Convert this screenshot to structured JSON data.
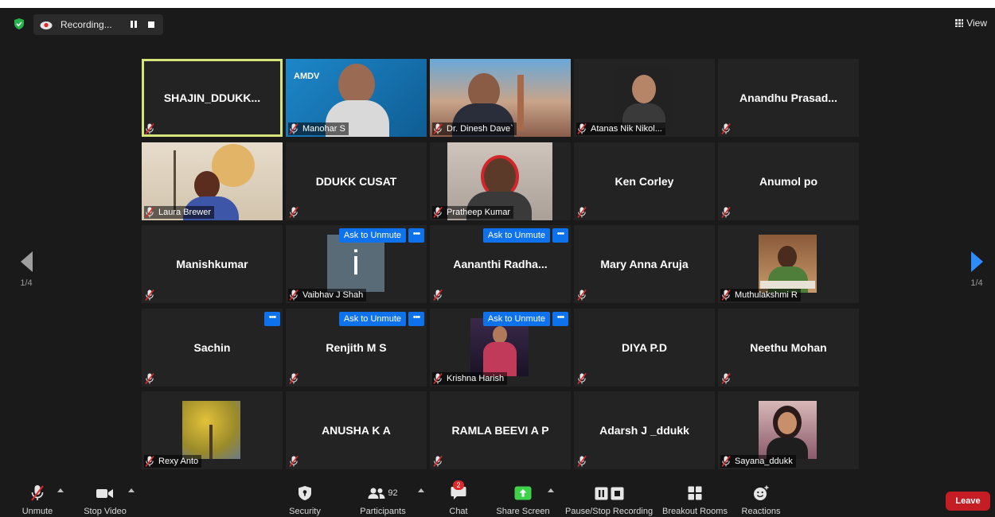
{
  "topbar": {
    "recording_label": "Recording...",
    "view_label": "View",
    "colors": {
      "shield": "#24b24b",
      "background": "#1a1a1a"
    }
  },
  "pagination": {
    "left_label": "1/4",
    "right_label": "1/4"
  },
  "tiles": [
    {
      "name": "SHAJIN_DDUKK...",
      "label": "",
      "active": true
    },
    {
      "name": "",
      "label": "Manohar S",
      "video": "amdv-presenter",
      "logo": "AMDV"
    },
    {
      "name": "",
      "label": "Dr. Dinesh Dave`",
      "video": "city-headset"
    },
    {
      "name": "",
      "label": "Atanas Nik Nikol...",
      "video": "portrait-small"
    },
    {
      "name": "Anandhu  Prasad...",
      "label": ""
    },
    {
      "name": "",
      "label": "Laura Brewer",
      "video": "living-room"
    },
    {
      "name": "DDUKK CUSAT",
      "label": ""
    },
    {
      "name": "",
      "label": "Pratheep Kumar",
      "video": "headphones"
    },
    {
      "name": "Ken Corley",
      "label": ""
    },
    {
      "name": "Anumol po",
      "label": ""
    },
    {
      "name": "Manishkumar",
      "label": ""
    },
    {
      "name": "",
      "label": "Vaibhav J Shah",
      "avatar_letter": "i",
      "ask_label": "Ask to Unmute",
      "more": true
    },
    {
      "name": "Aananthi  Radha...",
      "label": "",
      "ask_label": "Ask to Unmute",
      "more": true
    },
    {
      "name": "Mary Anna Aruja",
      "label": ""
    },
    {
      "name": "",
      "label": "Muthulakshmi R",
      "video": "office-photo"
    },
    {
      "name": "Sachin",
      "label": "",
      "more": true
    },
    {
      "name": "Renjith M S",
      "label": "",
      "ask_label": "Ask to Unmute",
      "more": true
    },
    {
      "name": "",
      "label": "Krishna Harish",
      "video": "stage-photo",
      "ask_label": "Ask to Unmute",
      "more": true
    },
    {
      "name": "DIYA P.D",
      "label": ""
    },
    {
      "name": "Neethu Mohan",
      "label": ""
    },
    {
      "name": "",
      "label": "Rexy Anto",
      "video": "tree-photo"
    },
    {
      "name": "ANUSHA K A",
      "label": ""
    },
    {
      "name": "RAMLA BEEVI A P",
      "label": ""
    },
    {
      "name": "Adarsh J _ddukk",
      "label": ""
    },
    {
      "name": "",
      "label": "Sayana_ddukk",
      "video": "selfie-photo"
    }
  ],
  "toolbar": {
    "unmute": "Unmute",
    "stop_video": "Stop Video",
    "security": "Security",
    "participants": "Participants",
    "participant_count": "92",
    "chat": "Chat",
    "chat_badge": "2",
    "share_screen": "Share Screen",
    "pause_recording": "Pause/Stop Recording",
    "breakout_rooms": "Breakout Rooms",
    "reactions": "Reactions",
    "leave": "Leave",
    "colors": {
      "share": "#3ed14a",
      "leave": "#c41e24",
      "unmute_slash": "#e02828"
    }
  }
}
